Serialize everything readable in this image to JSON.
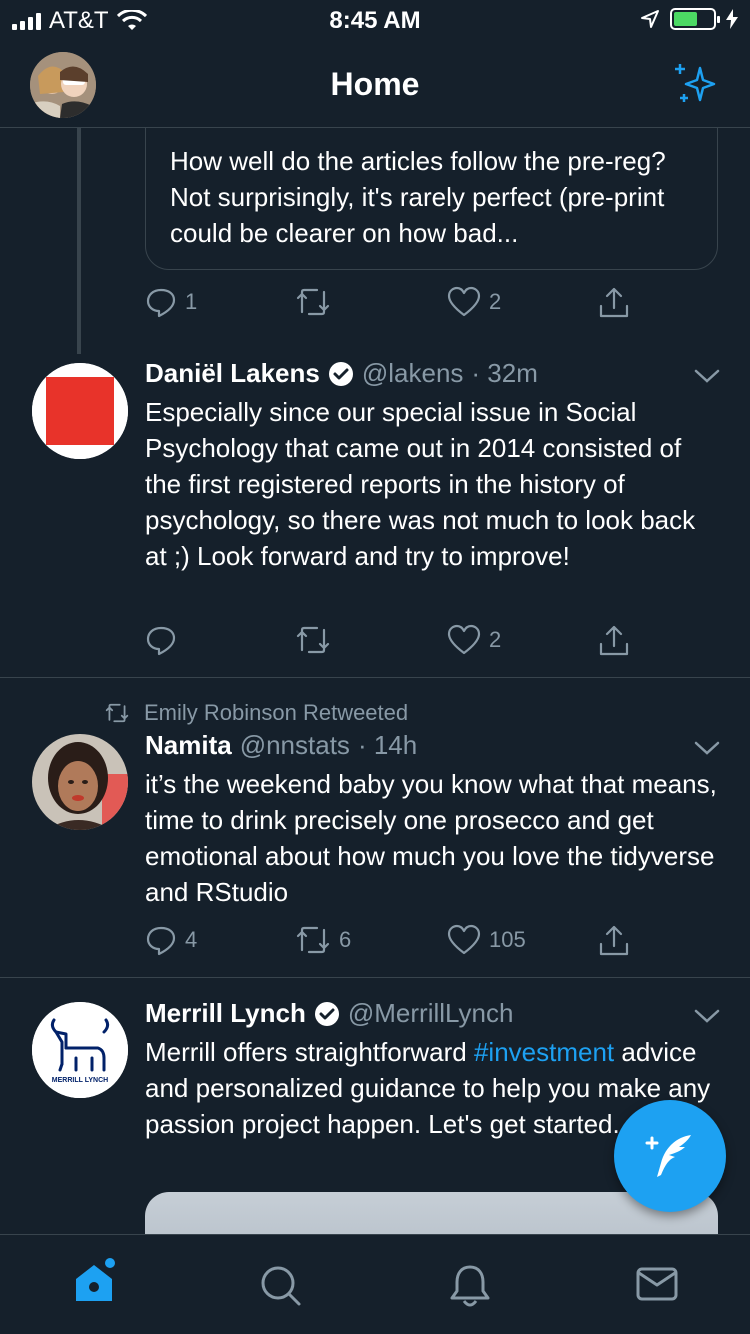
{
  "status_bar": {
    "carrier": "AT&T",
    "time": "8:45 AM"
  },
  "header": {
    "title": "Home"
  },
  "feed": {
    "quoted_tweet": {
      "text": "How well do the articles follow the pre-reg? Not surprisingly, it's rarely perfect (pre-print could be clearer on how bad...",
      "actions": {
        "replies": "1",
        "retweets": "",
        "likes": "2"
      }
    },
    "tweets": [
      {
        "name": "Daniël Lakens",
        "handle": "@lakens",
        "time": "· 32m",
        "verified": true,
        "text": "Especially since our special issue in Social Psychology that came out in 2014 consisted of the first registered reports in the history of psychology, so there was not much to look back at ;) Look forward and try to improve!",
        "actions": {
          "replies": "",
          "retweets": "",
          "likes": "2"
        }
      },
      {
        "retweeted_by": "Emily Robinson Retweeted",
        "name": "Namita",
        "handle": "@nnstats",
        "time": "· 14h",
        "verified": false,
        "text": "it’s the weekend baby you know what that means, time to drink precisely one prosecco and get emotional about how much you love the tidyverse and RStudio",
        "actions": {
          "replies": "4",
          "retweets": "6",
          "likes": "105"
        }
      },
      {
        "name": "Merrill Lynch",
        "handle": "@MerrillLynch",
        "verified": true,
        "avatar_caption": "MERRILL LYNCH",
        "text_before": "Merrill offers straightforward ",
        "hashtag": "#investment",
        "text_after": " advice and personalized guidance to help you make any passion project happen. Let's get started."
      }
    ]
  },
  "tab_bar": {
    "items": [
      "home-icon",
      "search-icon",
      "notifications-icon",
      "messages-icon"
    ],
    "active": "home-icon"
  },
  "colors": {
    "background": "#15202b",
    "accent": "#1da1f2",
    "secondary_text": "#8899a6",
    "divider": "#38444d",
    "battery": "#4cd964"
  }
}
